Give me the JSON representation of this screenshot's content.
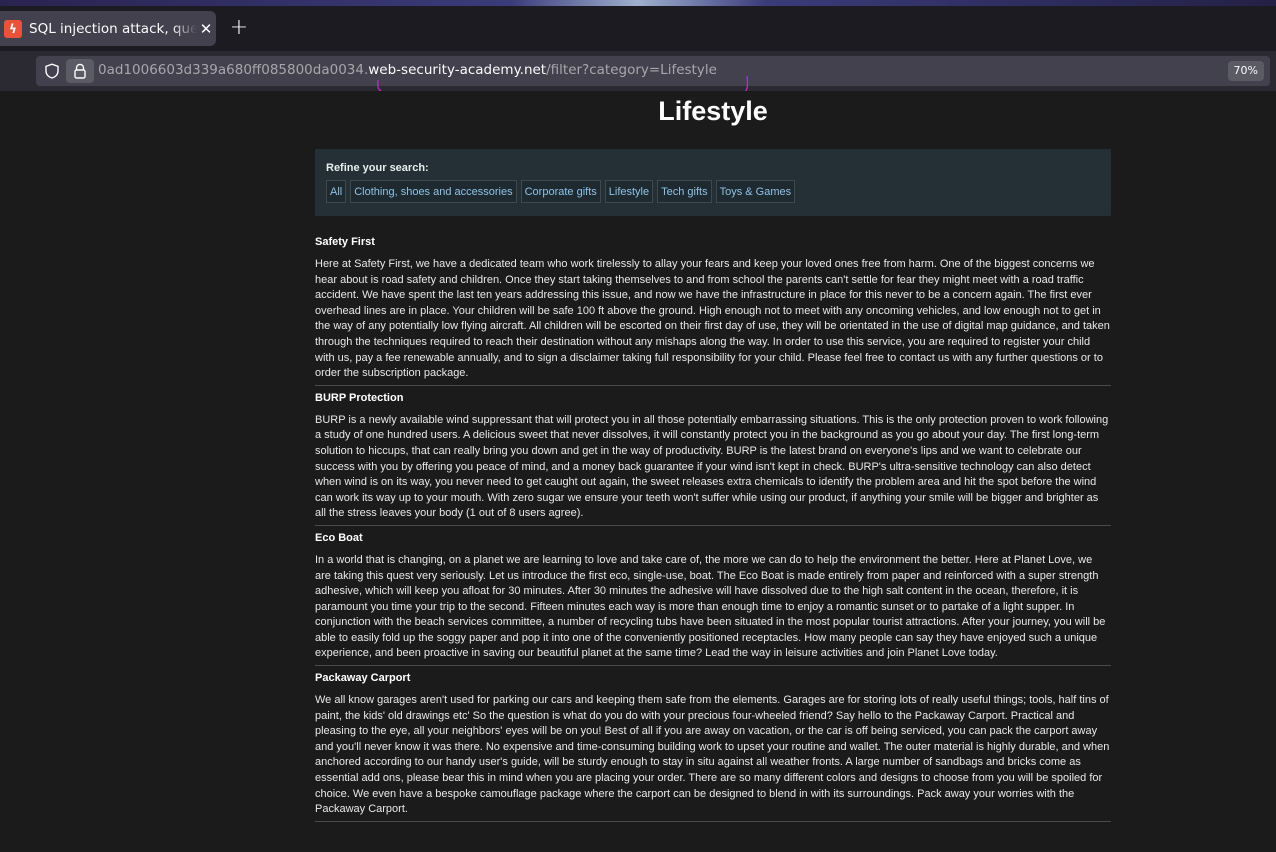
{
  "browser": {
    "tab": {
      "title": "SQL injection attack, query",
      "favicon": "burp-favicon-icon",
      "close_glyph": "✕"
    },
    "new_tab_glyph": "+",
    "url": {
      "prefix": "0ad1006603d339a680ff085800da0034.",
      "host": "web-security-academy.net",
      "path": "/filter?category=Lifestyle"
    },
    "zoom": "70%",
    "annotation_color": "#d11fd1"
  },
  "page": {
    "title": "Lifestyle",
    "filter": {
      "label": "Refine your search:",
      "categories": [
        "All",
        "Clothing, shoes and accessories",
        "Corporate gifts",
        "Lifestyle",
        "Tech gifts",
        "Toys & Games"
      ]
    },
    "posts": [
      {
        "title": "Safety First",
        "body": "Here at Safety First, we have a dedicated team who work tirelessly to allay your fears and keep your loved ones free from harm. One of the biggest concerns we hear about is road safety and children. Once they start taking themselves to and from school the parents can't settle for fear they might meet with a road traffic accident. We have spent the last ten years addressing this issue, and now we have the infrastructure in place for this never to be a concern again. The first ever overhead lines are in place. Your children will be safe 100 ft above the ground. High enough not to meet with any oncoming vehicles, and low enough not to get in the way of any potentially low flying aircraft. All children will be escorted on their first day of use, they will be orientated in the use of digital map guidance, and taken through the techniques required to reach their destination without any mishaps along the way. In order to use this service, you are required to register your child with us, pay a fee renewable annually, and to sign a disclaimer taking full responsibility for your child. Please feel free to contact us with any further questions or to order the subscription package."
      },
      {
        "title": "BURP Protection",
        "body": "BURP is a newly available wind suppressant that will protect you in all those potentially embarrassing situations. This is the only protection proven to work following a study of one hundred users. A delicious sweet that never dissolves, it will constantly protect you in the background as you go about your day. The first long-term solution to hiccups, that can really bring you down and get in the way of productivity. BURP is the latest brand on everyone's lips and we want to celebrate our success with you by offering you peace of mind, and a money back guarantee if your wind isn't kept in check. BURP's ultra-sensitive technology can also detect when wind is on its way, you never need to get caught out again, the sweet releases extra chemicals to identify the problem area and hit the spot before the wind can work its way up to your mouth. With zero sugar we ensure your teeth won't suffer while using our product, if anything your smile will be bigger and brighter as all the stress leaves your body (1 out of 8 users agree)."
      },
      {
        "title": "Eco Boat",
        "body": "In a world that is changing, on a planet we are learning to love and take care of, the more we can do to help the environment the better. Here at Planet Love, we are taking this quest very seriously. Let us introduce the first eco, single-use, boat. The Eco Boat is made entirely from paper and reinforced with a super strength adhesive, which will keep you afloat for 30 minutes. After 30 minutes the adhesive will have dissolved due to the high salt content in the ocean, therefore, it is paramount you time your trip to the second. Fifteen minutes each way is more than enough time to enjoy a romantic sunset or to partake of a light supper. In conjunction with the beach services committee, a number of recycling tubs have been situated in the most popular tourist attractions. After your journey, you will be able to easily fold up the soggy paper and pop it into one of the conveniently positioned receptacles. How many people can say they have enjoyed such a unique experience, and been proactive in saving our beautiful planet at the same time? Lead the way in leisure activities and join Planet Love today."
      },
      {
        "title": "Packaway Carport",
        "body": "We all know garages aren't used for parking our cars and keeping them safe from the elements. Garages are for storing lots of really useful things; tools, half tins of paint, the kids' old drawings etc' So the question is what do you do with your precious four-wheeled friend? Say hello to the Packaway Carport. Practical and pleasing to the eye, all your neighbors' eyes will be on you! Best of all if you are away on vacation, or the car is off being serviced, you can pack the carport away and you'll never know it was there. No expensive and time-consuming building work to upset your routine and wallet. The outer material is highly durable, and when anchored according to our handy user's guide, will be sturdy enough to stay in situ against all weather fronts. A large number of sandbags and bricks come as essential add ons, please bear this in mind when you are placing your order. There are so many different colors and designs to choose from you will be spoiled for choice. We even have a bespoke camouflage package where the carport can be designed to blend in with its surroundings. Pack away your worries with the Packaway Carport."
      }
    ]
  }
}
